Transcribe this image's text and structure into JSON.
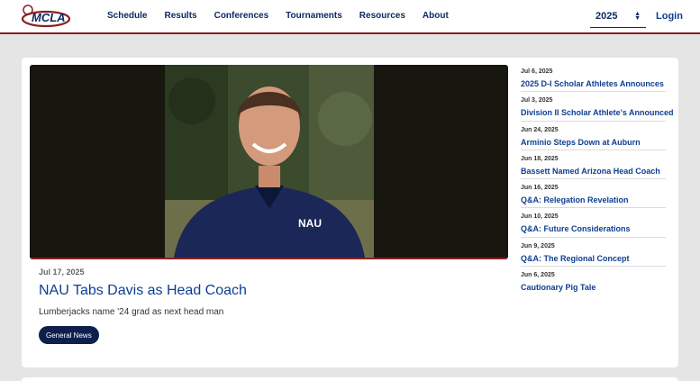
{
  "header": {
    "logo_text": "MCLA",
    "nav": [
      "Schedule",
      "Results",
      "Conferences",
      "Tournaments",
      "Resources",
      "About"
    ],
    "season": "2025",
    "login": "Login",
    "brand_color": "#0e2a63",
    "accent_color": "#8a1f24"
  },
  "featured": {
    "date": "Jul 17, 2025",
    "title": "NAU Tabs Davis as Head Coach",
    "subtitle": "Lumberjacks name '24 grad as next head man",
    "tag": "General News",
    "shirt_text": "NAU"
  },
  "news": [
    {
      "date": "Jul 6, 2025",
      "title": "2025 D-I Scholar Athletes Announces"
    },
    {
      "date": "Jul 3, 2025",
      "title": "Division II Scholar Athlete's Announced"
    },
    {
      "date": "Jun 24, 2025",
      "title": "Arminio Steps Down at Auburn"
    },
    {
      "date": "Jun 18, 2025",
      "title": "Bassett Named Arizona Head Coach"
    },
    {
      "date": "Jun 16, 2025",
      "title": "Q&A: Relegation Revelation"
    },
    {
      "date": "Jun 10, 2025",
      "title": "Q&A: Future Considerations"
    },
    {
      "date": "Jun 9, 2025",
      "title": "Q&A: The Regional Concept"
    },
    {
      "date": "Jun 6, 2025",
      "title": "Cautionary Pig Tale"
    }
  ]
}
